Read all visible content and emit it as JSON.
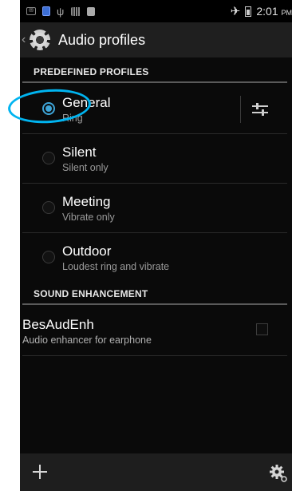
{
  "status_bar": {
    "time": "2:01",
    "ampm": "PM",
    "icons": [
      "mail-icon",
      "app-icon",
      "usb-icon",
      "grid-icon",
      "square-icon",
      "airplane-icon",
      "battery-icon"
    ]
  },
  "action_bar": {
    "title": "Audio profiles",
    "icon": "gear-icon"
  },
  "sections": [
    {
      "header": "PREDEFINED PROFILES",
      "profiles": [
        {
          "title": "General",
          "subtitle": "Ring",
          "selected": true
        },
        {
          "title": "Silent",
          "subtitle": "Silent only",
          "selected": false
        },
        {
          "title": "Meeting",
          "subtitle": "Vibrate only",
          "selected": false
        },
        {
          "title": "Outdoor",
          "subtitle": "Loudest ring and vibrate",
          "selected": false
        }
      ]
    },
    {
      "header": "SOUND ENHANCEMENT",
      "items": [
        {
          "title": "BesAudEnh",
          "subtitle": "Audio enhancer for earphone",
          "checked": false
        }
      ]
    }
  ],
  "bottom_bar": {
    "add": "plus-icon",
    "settings": "settings-gear-icon"
  },
  "colors": {
    "accent": "#3ea5d8",
    "annotation": "#00b4f0",
    "background": "#0a0a0a"
  }
}
